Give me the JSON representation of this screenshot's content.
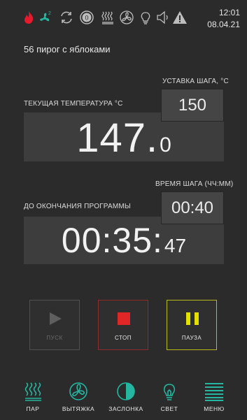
{
  "status_bar": {
    "icons": [
      "flame-icon",
      "fan-speed-icon",
      "cycle-icon",
      "counter-icon",
      "steam-icon",
      "exhaust-fan-icon",
      "light-bulb-icon",
      "sound-icon",
      "warning-icon"
    ],
    "counter_value": "0",
    "fan_speed": "2",
    "time": "12:01",
    "date": "08.04.21"
  },
  "program": {
    "name": "56 пирог с яблоками"
  },
  "temperature": {
    "setpoint_label": "УСТАВКА ШАГА, °C",
    "setpoint_value": "150",
    "current_label": "ТЕКУЩАЯ ТЕМПЕРАТУРА °C",
    "current_main": "147.",
    "current_fraction": "0"
  },
  "timer": {
    "step_time_label": "ВРЕМЯ ШАГА (ЧЧ:ММ)",
    "step_time_value": "00:40",
    "remaining_label": "ДО ОКОНЧАНИЯ ПРОГРАММЫ",
    "remaining_main": "00:35:",
    "remaining_seconds": "47"
  },
  "controls": {
    "start_label": "ПУСК",
    "stop_label": "СТОП",
    "pause_label": "ПАУЗА",
    "start_enabled": false
  },
  "colors": {
    "background": "#2b2b2b",
    "accent_teal": "#24b6a0",
    "flame_red": "#e8192c",
    "stop_red": "#e02626",
    "pause_yellow": "#e3e000"
  },
  "nav": {
    "items": [
      {
        "label": "ПАР",
        "icon": "steam-icon"
      },
      {
        "label": "ВЫТЯЖКА",
        "icon": "exhaust-fan-icon"
      },
      {
        "label": "ЗАСЛОНКА",
        "icon": "damper-icon"
      },
      {
        "label": "СВЕТ",
        "icon": "light-bulb-icon"
      },
      {
        "label": "МЕНЮ",
        "icon": "menu-icon"
      }
    ]
  }
}
